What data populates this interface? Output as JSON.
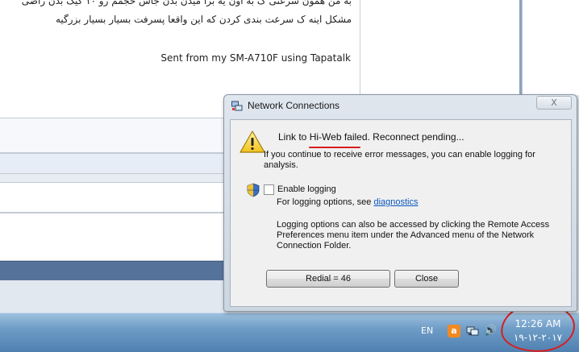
{
  "background": {
    "post_line_1": "به من همون سرعتی ک به اون یه برا میدن بدن جاش حجمم رو ۱۰ گیگ بدن راضی",
    "post_line_2": "مشکل اینه ک سرعت بندی کردن که این واقعا پسرفت بسیار بسیار بزرگیه",
    "signature": "Sent from my SM-A710F using Tapatalk"
  },
  "dialog": {
    "title": "Network Connections",
    "close_label": "X",
    "message_prefix": "Link to ",
    "message_highlight": "Hi-Web failed.",
    "message_suffix": "  Reconnect pending...",
    "sub_message": "If you continue to receive error messages, you can enable logging for analysis.",
    "enable_logging_label": "Enable logging",
    "enable_logging_checked": false,
    "log_options_prefix": "For logging options, see ",
    "log_options_link": "diagnostics",
    "log_paragraph": "Logging options can also be accessed by clicking the Remote Access Preferences menu item under the Advanced menu of the Network Connection Folder.",
    "redial_label": "Redial = 46",
    "close_button_label": "Close"
  },
  "taskbar": {
    "language": "EN",
    "clock_time": "12:26 AM",
    "clock_date": "۱۹-۱۲-۲۰۱۷"
  },
  "colors": {
    "annotation_red": "#d81e1e",
    "link_blue": "#0b57c0",
    "taskbar_blue": "#4f80b0"
  }
}
